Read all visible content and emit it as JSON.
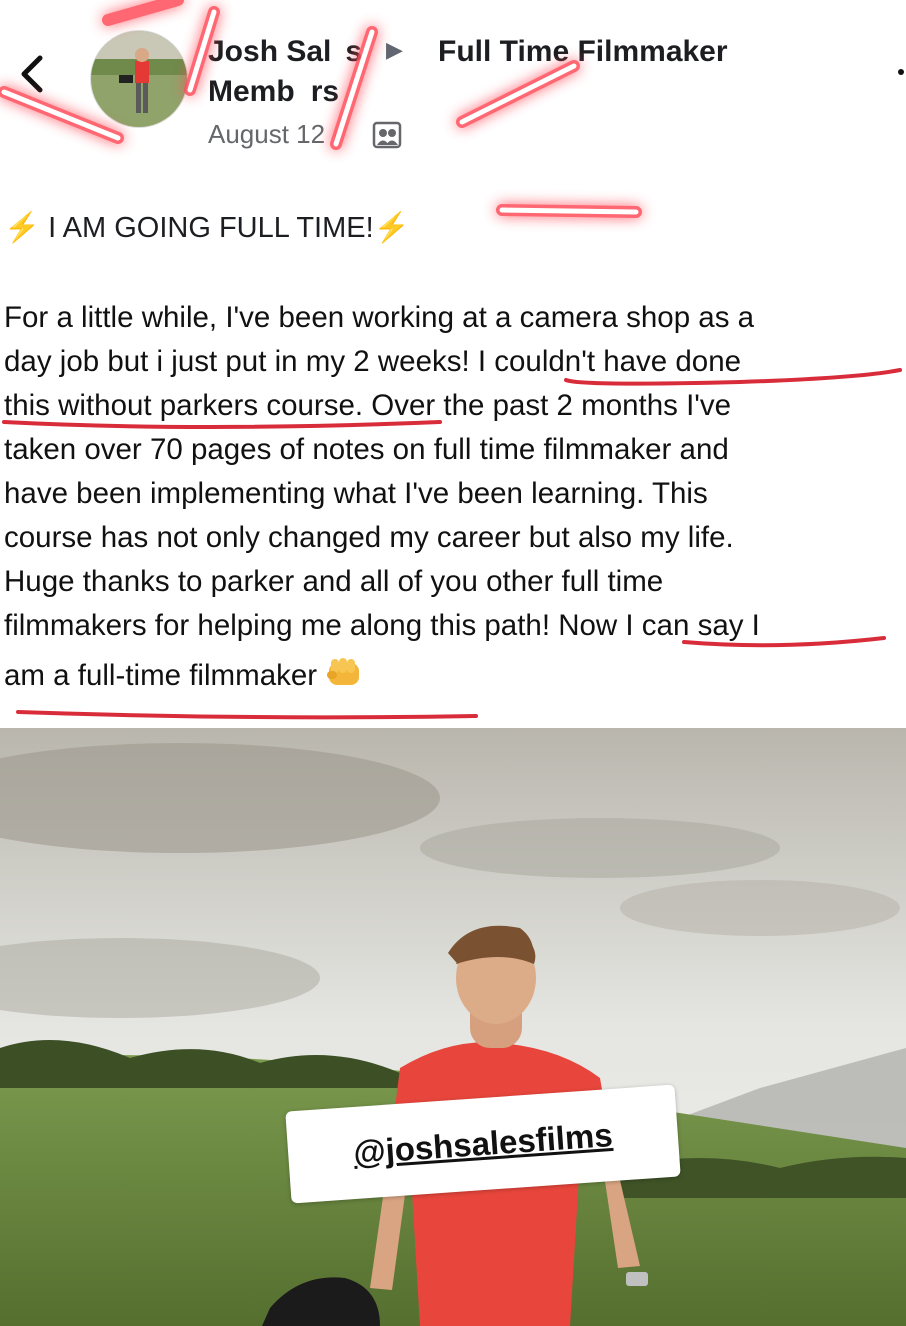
{
  "post": {
    "author_line1": "Josh Sal",
    "author_line1_tail": "s",
    "author_line2": "Memb",
    "author_line2_tail": "rs",
    "arrow": "▶",
    "group_name": "Full Time Filmmaker",
    "date": "August 12 ·",
    "headline": "I AM GOING FULL TIME!",
    "headline_bolt": "⚡",
    "body_lines": [
      "For a little while, I've been working at a camera shop as a",
      "day job but i just put in my 2 weeks! I couldn't have done",
      "this without parkers course. Over the past 2 months I've",
      "taken over 70 pages of notes on full time filmmaker and",
      "have been implementing what I've been learning. This",
      "course has not only changed my career but also my life.",
      "Huge thanks to parker and all of you other full time",
      "filmmakers for helping me along this path! Now I can say I",
      "am a full-time filmmaker"
    ]
  },
  "photo": {
    "tag_text": "@joshsalesfilms"
  },
  "icons": [
    "back-arrow-icon",
    "privacy-icon",
    "fist-icon",
    "more-options-icon"
  ],
  "colors": {
    "underline": "#d92c3a",
    "scribble": "#ff4d5a",
    "bolt": "#f5b921"
  }
}
